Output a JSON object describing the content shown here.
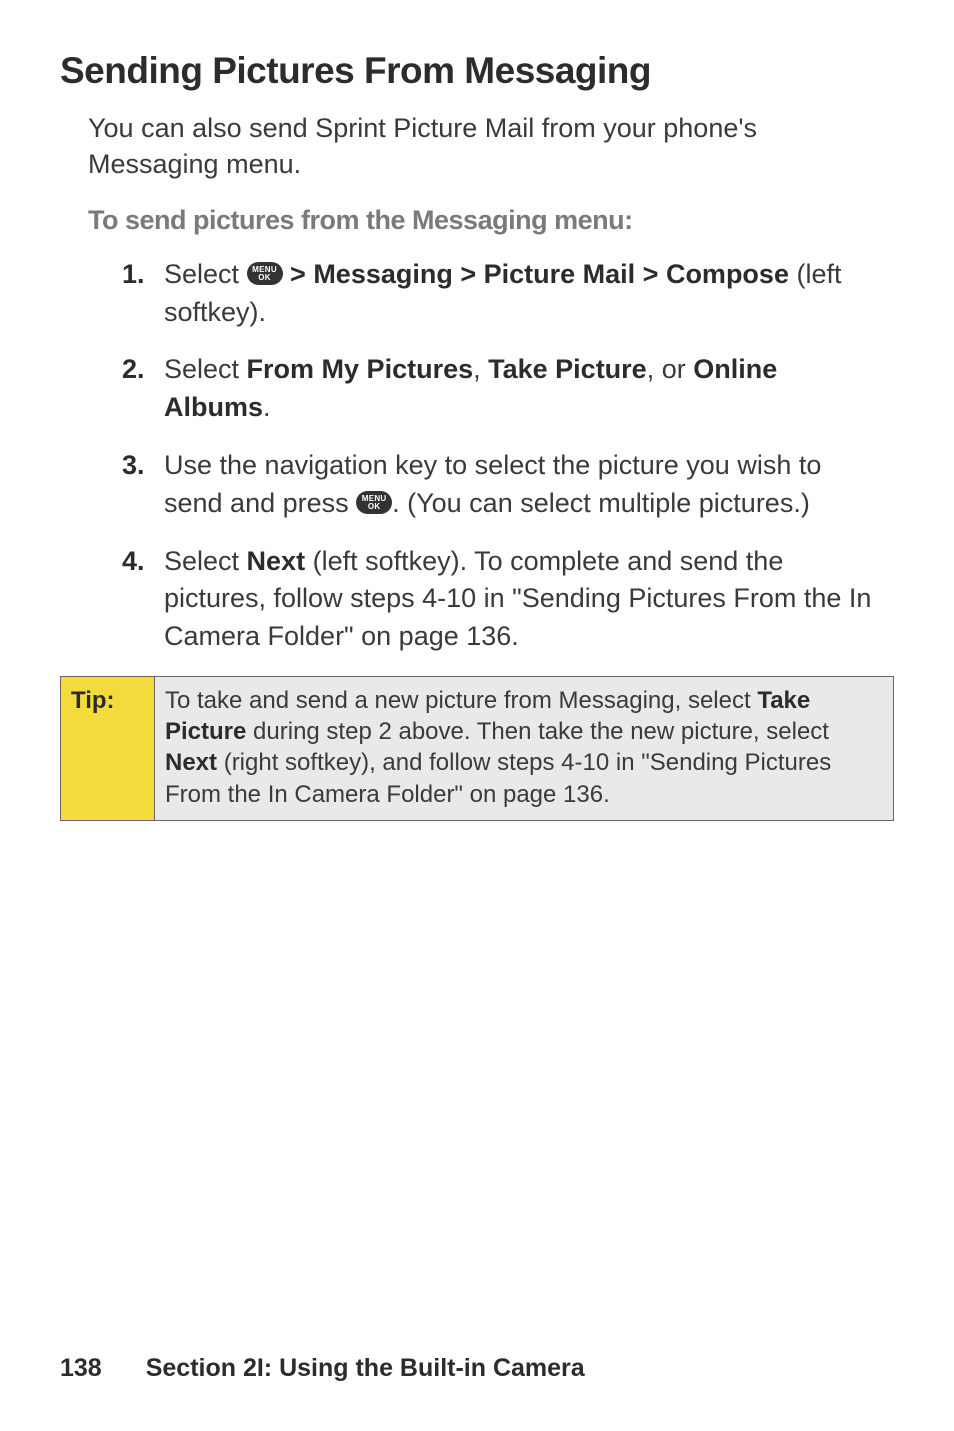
{
  "heading": "Sending Pictures From Messaging",
  "intro": "You can also send Sprint Picture Mail from your phone's Messaging menu.",
  "subhead": "To send pictures from the Messaging menu:",
  "icon": {
    "label_top": "MENU",
    "label_bottom": "OK"
  },
  "steps": {
    "s1": {
      "num": "1.",
      "pre": "Select ",
      "bold": " > Messaging > Picture Mail > Compose",
      "post": " (left softkey)."
    },
    "s2": {
      "num": "2.",
      "pre": "Select ",
      "b1": "From My Pictures",
      "mid1": ", ",
      "b2": "Take Picture",
      "mid2": ", or ",
      "b3": "Online Albums",
      "post": "."
    },
    "s3": {
      "num": "3.",
      "pre": "Use the navigation key to select the picture you wish to send and press ",
      "post": ". (You can select multiple pictures.)"
    },
    "s4": {
      "num": "4.",
      "pre": "Select ",
      "b1": "Next",
      "post": " (left softkey). To complete and send the pictures, follow steps 4-10 in \"Sending Pictures From the In Camera Folder\" on page 136."
    }
  },
  "tip": {
    "label": "Tip:",
    "t1": "To take and send a new picture from Messaging, select ",
    "b1": "Take Picture",
    "t2": " during step 2 above. Then take the new picture, select ",
    "b2": "Next",
    "t3": " (right softkey), and follow steps 4-10 in \"Sending Pictures From the In Camera Folder\" on page 136."
  },
  "footer": {
    "page": "138",
    "section": "Section 2I: Using the Built-in Camera"
  }
}
